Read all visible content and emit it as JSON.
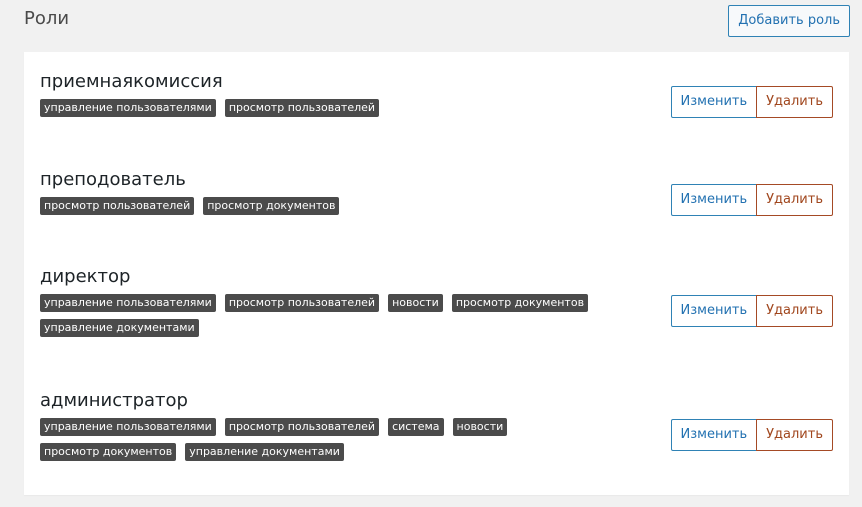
{
  "header": {
    "title": "Роли",
    "add_role_label": "Добавить роль"
  },
  "actions": {
    "edit_label": "Изменить",
    "delete_label": "Удалить"
  },
  "roles": [
    {
      "name": "приемнаякомиссия",
      "permissions": [
        "управление пользователями",
        "просмотр пользователей"
      ]
    },
    {
      "name": "преподователь",
      "permissions": [
        "просмотр пользователей",
        "просмотр документов"
      ]
    },
    {
      "name": "директор",
      "permissions": [
        "управление пользователями",
        "просмотр пользователей",
        "новости",
        "просмотр документов",
        "управление документами"
      ]
    },
    {
      "name": "администратор",
      "permissions": [
        "управление пользователями",
        "просмотр пользователей",
        "система",
        "новости",
        "просмотр документов",
        "управление документами"
      ]
    }
  ]
}
